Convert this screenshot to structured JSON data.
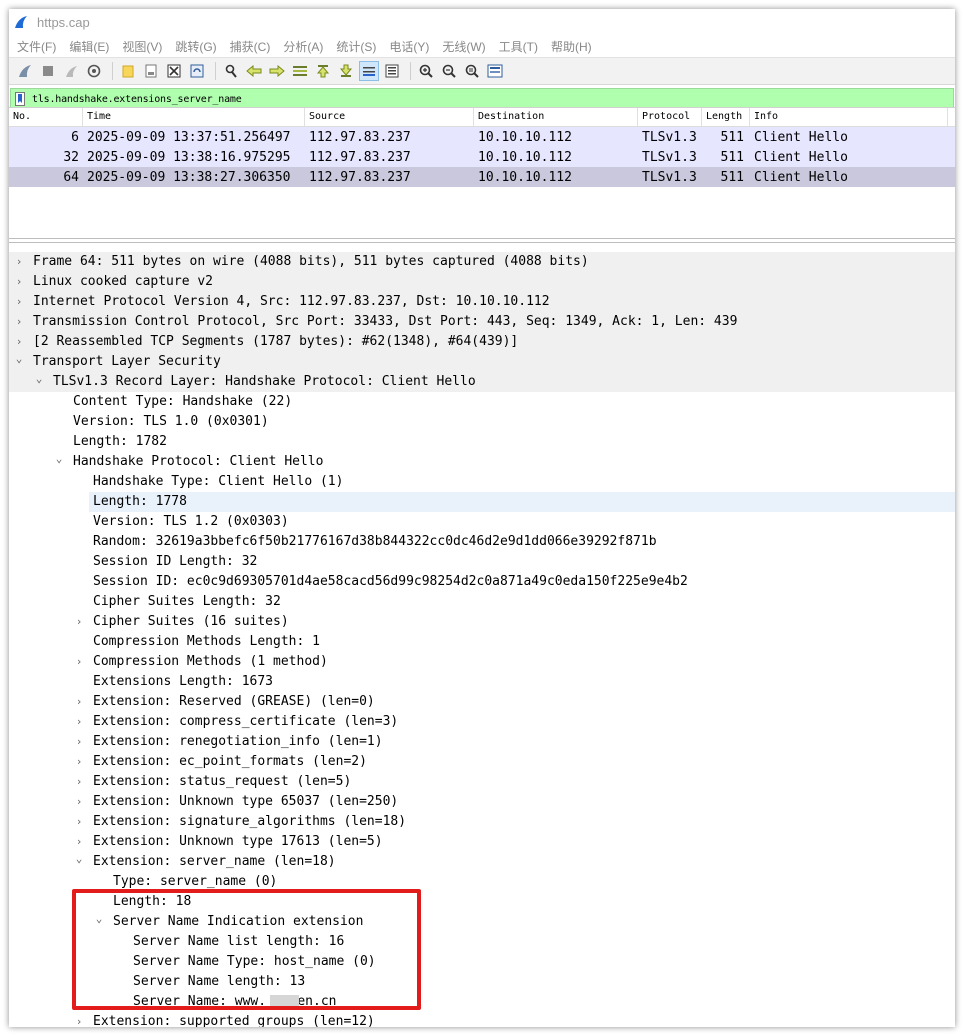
{
  "window": {
    "title": "https.cap"
  },
  "menu": [
    "文件(F)",
    "编辑(E)",
    "视图(V)",
    "跳转(G)",
    "捕获(C)",
    "分析(A)",
    "统计(S)",
    "电话(Y)",
    "无线(W)",
    "工具(T)",
    "帮助(H)"
  ],
  "toolbar_icons": [
    "shark-fin-start-icon",
    "stop-icon",
    "restart-icon",
    "options-gear-icon",
    "open-folder-icon",
    "open-file-icon",
    "close-file-icon",
    "reload-icon",
    "find-icon",
    "back-arrow-icon",
    "forward-arrow-icon",
    "go-to-packet-icon",
    "first-packet-icon",
    "last-packet-icon",
    "autoscroll-icon",
    "colorize-icon",
    "zoom-in-icon",
    "zoom-out-icon",
    "normal-size-icon",
    "resize-columns-icon"
  ],
  "filter": {
    "value": "tls.handshake.extensions_server_name",
    "bg": "#afffaf"
  },
  "packet_list": {
    "columns": [
      "No.",
      "Time",
      "Source",
      "Destination",
      "Protocol",
      "Length",
      "Info"
    ],
    "rows": [
      {
        "no": "6",
        "time": "2025-09-09 13:37:51.256497",
        "src": "112.97.83.237",
        "dst": "10.10.10.112",
        "proto": "TLSv1.3",
        "len": "511",
        "info": "Client Hello"
      },
      {
        "no": "32",
        "time": "2025-09-09 13:38:16.975295",
        "src": "112.97.83.237",
        "dst": "10.10.10.112",
        "proto": "TLSv1.3",
        "len": "511",
        "info": "Client Hello"
      },
      {
        "no": "64",
        "time": "2025-09-09 13:38:27.306350",
        "src": "112.97.83.237",
        "dst": "10.10.10.112",
        "proto": "TLSv1.3",
        "len": "511",
        "info": "Client Hello"
      }
    ],
    "row_color": "#e7e6ff",
    "selected_color": "#c9c8dd"
  },
  "details": [
    {
      "text": "Frame 64: 511 bytes on wire (4088 bits), 511 bytes captured (4088 bits)",
      "level": 0,
      "toggle": "collapsed"
    },
    {
      "text": "Linux cooked capture v2",
      "level": 0,
      "toggle": "collapsed"
    },
    {
      "text": "Internet Protocol Version 4, Src: 112.97.83.237, Dst: 10.10.10.112",
      "level": 0,
      "toggle": "collapsed"
    },
    {
      "text": "Transmission Control Protocol, Src Port: 33433, Dst Port: 443, Seq: 1349, Ack: 1, Len: 439",
      "level": 0,
      "toggle": "collapsed"
    },
    {
      "text": "[2 Reassembled TCP Segments (1787 bytes): #62(1348), #64(439)]",
      "level": 0,
      "toggle": "collapsed"
    },
    {
      "text": "Transport Layer Security",
      "level": 0,
      "toggle": "expanded"
    },
    {
      "text": "TLSv1.3 Record Layer: Handshake Protocol: Client Hello",
      "level": 1,
      "toggle": "expanded"
    },
    {
      "text": "Content Type: Handshake (22)",
      "level": 2,
      "toggle": "none"
    },
    {
      "text": "Version: TLS 1.0 (0x0301)",
      "level": 2,
      "toggle": "none"
    },
    {
      "text": "Length: 1782",
      "level": 2,
      "toggle": "none"
    },
    {
      "text": "Handshake Protocol: Client Hello",
      "level": 2,
      "toggle": "expanded"
    },
    {
      "text": "Handshake Type: Client Hello (1)",
      "level": 3,
      "toggle": "none"
    },
    {
      "text": "Length: 1778",
      "level": 3,
      "toggle": "none",
      "highlight": true
    },
    {
      "text": "Version: TLS 1.2 (0x0303)",
      "level": 3,
      "toggle": "none"
    },
    {
      "text": "Random: 32619a3bbefc6f50b21776167d38b844322cc0dc46d2e9d1dd066e39292f871b",
      "level": 3,
      "toggle": "none"
    },
    {
      "text": "Session ID Length: 32",
      "level": 3,
      "toggle": "none"
    },
    {
      "text": "Session ID: ec0c9d69305701d4ae58cacd56d99c98254d2c0a871a49c0eda150f225e9e4b2",
      "level": 3,
      "toggle": "none"
    },
    {
      "text": "Cipher Suites Length: 32",
      "level": 3,
      "toggle": "none"
    },
    {
      "text": "Cipher Suites (16 suites)",
      "level": 3,
      "toggle": "collapsed"
    },
    {
      "text": "Compression Methods Length: 1",
      "level": 3,
      "toggle": "none"
    },
    {
      "text": "Compression Methods (1 method)",
      "level": 3,
      "toggle": "collapsed"
    },
    {
      "text": "Extensions Length: 1673",
      "level": 3,
      "toggle": "none"
    },
    {
      "text": "Extension: Reserved (GREASE) (len=0)",
      "level": 3,
      "toggle": "collapsed"
    },
    {
      "text": "Extension: compress_certificate (len=3)",
      "level": 3,
      "toggle": "collapsed"
    },
    {
      "text": "Extension: renegotiation_info (len=1)",
      "level": 3,
      "toggle": "collapsed"
    },
    {
      "text": "Extension: ec_point_formats (len=2)",
      "level": 3,
      "toggle": "collapsed"
    },
    {
      "text": "Extension: status_request (len=5)",
      "level": 3,
      "toggle": "collapsed"
    },
    {
      "text": "Extension: Unknown type 65037 (len=250)",
      "level": 3,
      "toggle": "collapsed"
    },
    {
      "text": "Extension: signature_algorithms (len=18)",
      "level": 3,
      "toggle": "collapsed"
    },
    {
      "text": "Extension: Unknown type 17613 (len=5)",
      "level": 3,
      "toggle": "collapsed"
    },
    {
      "text": "Extension: server_name (len=18)",
      "level": 3,
      "toggle": "expanded"
    },
    {
      "text": "Type: server_name (0)",
      "level": 4,
      "toggle": "none"
    },
    {
      "text": "Length: 18",
      "level": 4,
      "toggle": "none"
    },
    {
      "text": "Server Name Indication extension",
      "level": 4,
      "toggle": "expanded"
    },
    {
      "text": "Server Name list length: 16",
      "level": 5,
      "toggle": "none"
    },
    {
      "text": "Server Name Type: host_name (0)",
      "level": 5,
      "toggle": "none"
    },
    {
      "text": "Server Name length: 13",
      "level": 5,
      "toggle": "none"
    },
    {
      "text": "Server Name: www.    en.cn",
      "level": 5,
      "toggle": "none",
      "redacted": true
    },
    {
      "text": "Extension: supported_groups (len=12)",
      "level": 3,
      "toggle": "collapsed"
    }
  ],
  "annotation_color": "#e21b1b"
}
